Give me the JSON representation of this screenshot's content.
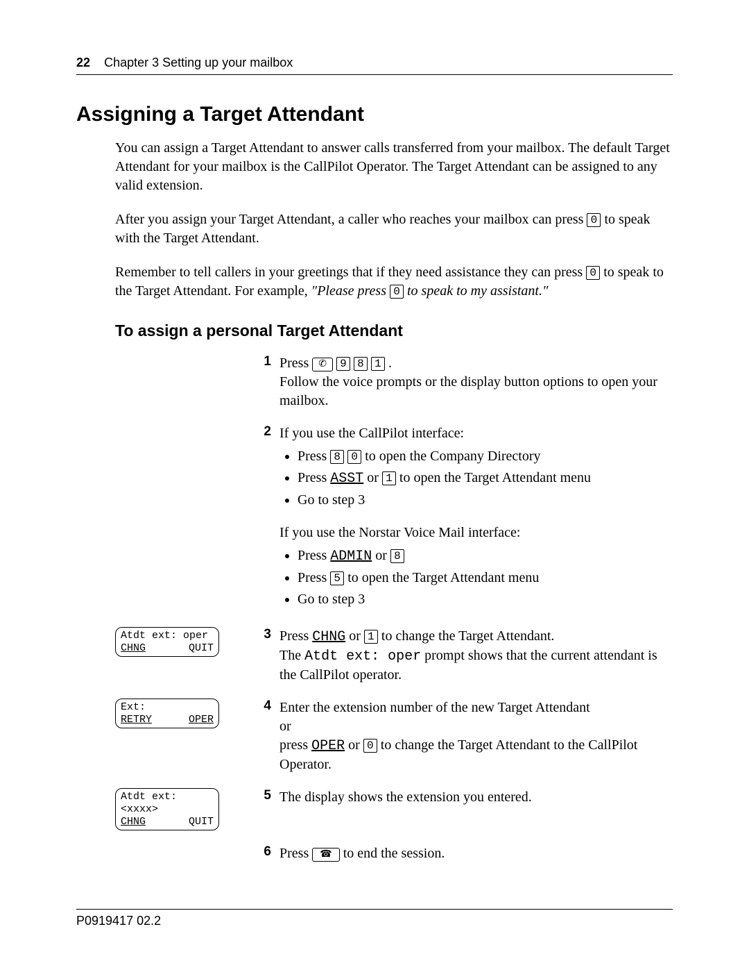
{
  "header": {
    "page_number": "22",
    "chapter_text": "Chapter 3  Setting up your mailbox"
  },
  "h1": "Assigning a Target Attendant",
  "intro": {
    "p1": "You can assign a Target Attendant to answer calls transferred from your mailbox. The default Target Attendant for your mailbox is the CallPilot Operator. The Target Attendant can be assigned to any valid extension.",
    "p2a": "After you assign your Target Attendant, a caller who reaches your mailbox can press ",
    "p2_key": "0",
    "p2b": " to speak with the Target Attendant.",
    "p3a": "Remember to tell callers in your greetings that if they need assistance they can press ",
    "p3_key": "0",
    "p3b": " to speak to the Target Attendant. For example, ",
    "p3_quote_a": "\"Please press ",
    "p3_quote_key": "0",
    "p3_quote_b": " to speak to my assistant.\""
  },
  "h2": "To assign a personal Target Attendant",
  "steps": {
    "s1": {
      "num": "1",
      "press": "Press ",
      "feature_glyph": "✆",
      "k1": "9",
      "k2": "8",
      "k3": "1",
      "dot": " .",
      "line2": "Follow the voice prompts or the display button options to open your mailbox."
    },
    "s2": {
      "num": "2",
      "line1": "If you use the CallPilot interface:",
      "b1a": "Press ",
      "b1_k1": "8",
      "b1_k2": "0",
      "b1b": " to open the Company Directory",
      "b2a": "Press ",
      "b2_soft": "ASST",
      "b2_or": " or ",
      "b2_k": "1",
      "b2b": " to open the Target Attendant menu",
      "b3": "Go to step 3",
      "line2": "If you use the Norstar Voice Mail interface:",
      "c1a": "Press ",
      "c1_soft": "ADMIN",
      "c1_or": " or ",
      "c1_k": "8",
      "c2a": "Press ",
      "c2_k": "5",
      "c2b": " to open the Target Attendant menu",
      "c3": "Go to step 3"
    },
    "s3": {
      "num": "3",
      "lcd_line1": "Atdt ext: oper",
      "lcd_left": "CHNG",
      "lcd_right": "QUIT",
      "a": "Press ",
      "soft": "CHNG",
      "or": " or ",
      "k": "1",
      "b": " to change the Target Attendant.",
      "line2a": "The ",
      "line2_mono": "Atdt ext: oper",
      "line2b": " prompt shows that the current attendant is the CallPilot operator."
    },
    "s4": {
      "num": "4",
      "lcd_line1": "Ext:",
      "lcd_left": "RETRY",
      "lcd_right": "OPER",
      "line1": "Enter the extension number of the new Target Attendant",
      "or": "or",
      "line2a": "press ",
      "soft": "OPER",
      "or2": " or ",
      "k": "0",
      "line2b": " to change the Target Attendant to the CallPilot Operator."
    },
    "s5": {
      "num": "5",
      "lcd_line1": "Atdt ext:<xxxx>",
      "lcd_left": "CHNG",
      "lcd_right": "QUIT",
      "text": "The display shows the extension you entered."
    },
    "s6": {
      "num": "6",
      "a": "Press ",
      "rls_glyph": "☎",
      "b": " to end the session."
    }
  },
  "footer": "P0919417 02.2"
}
